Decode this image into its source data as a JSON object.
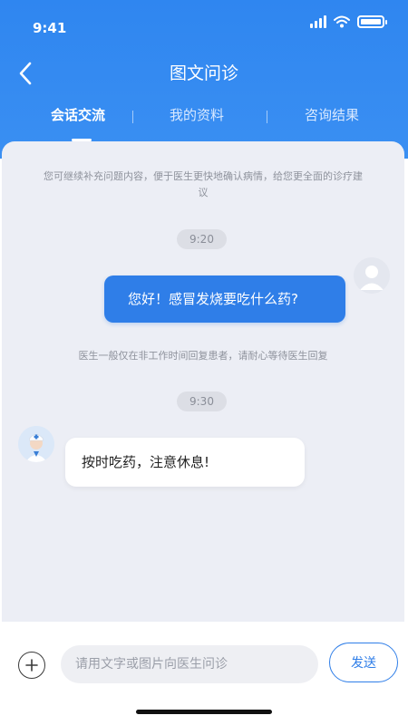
{
  "status": {
    "time": "9:41",
    "icons": [
      "signal-icon",
      "wifi-icon",
      "battery-icon"
    ]
  },
  "header": {
    "title": "图文问诊",
    "back_icon": "chevron-left-icon"
  },
  "tabs": [
    {
      "label": "会话交流",
      "active": true
    },
    {
      "label": "我的资料",
      "active": false
    },
    {
      "label": "咨询结果",
      "active": false
    }
  ],
  "chat": {
    "notice_top": "您可继续补充问题内容，便于医生更快地确认病情，给您更全面的诊疗建议",
    "messages": [
      {
        "time": "9:20",
        "sender": "user",
        "text": "您好！感冒发烧要吃什么药?"
      },
      {
        "time": "9:30",
        "sender": "doctor",
        "text": "按时吃药，注意休息!"
      }
    ],
    "notice_mid": "医生一般仅在非工作时间回复患者，请耐心等待医生回复"
  },
  "input_bar": {
    "plus_icon": "plus-circle-icon",
    "placeholder": "请用文字或图片向医生问诊",
    "value": "",
    "send_label": "发送"
  },
  "colors": {
    "primary": "#2f86f0",
    "bubble_user": "#2f7ee8",
    "chat_bg": "#eceef5"
  }
}
